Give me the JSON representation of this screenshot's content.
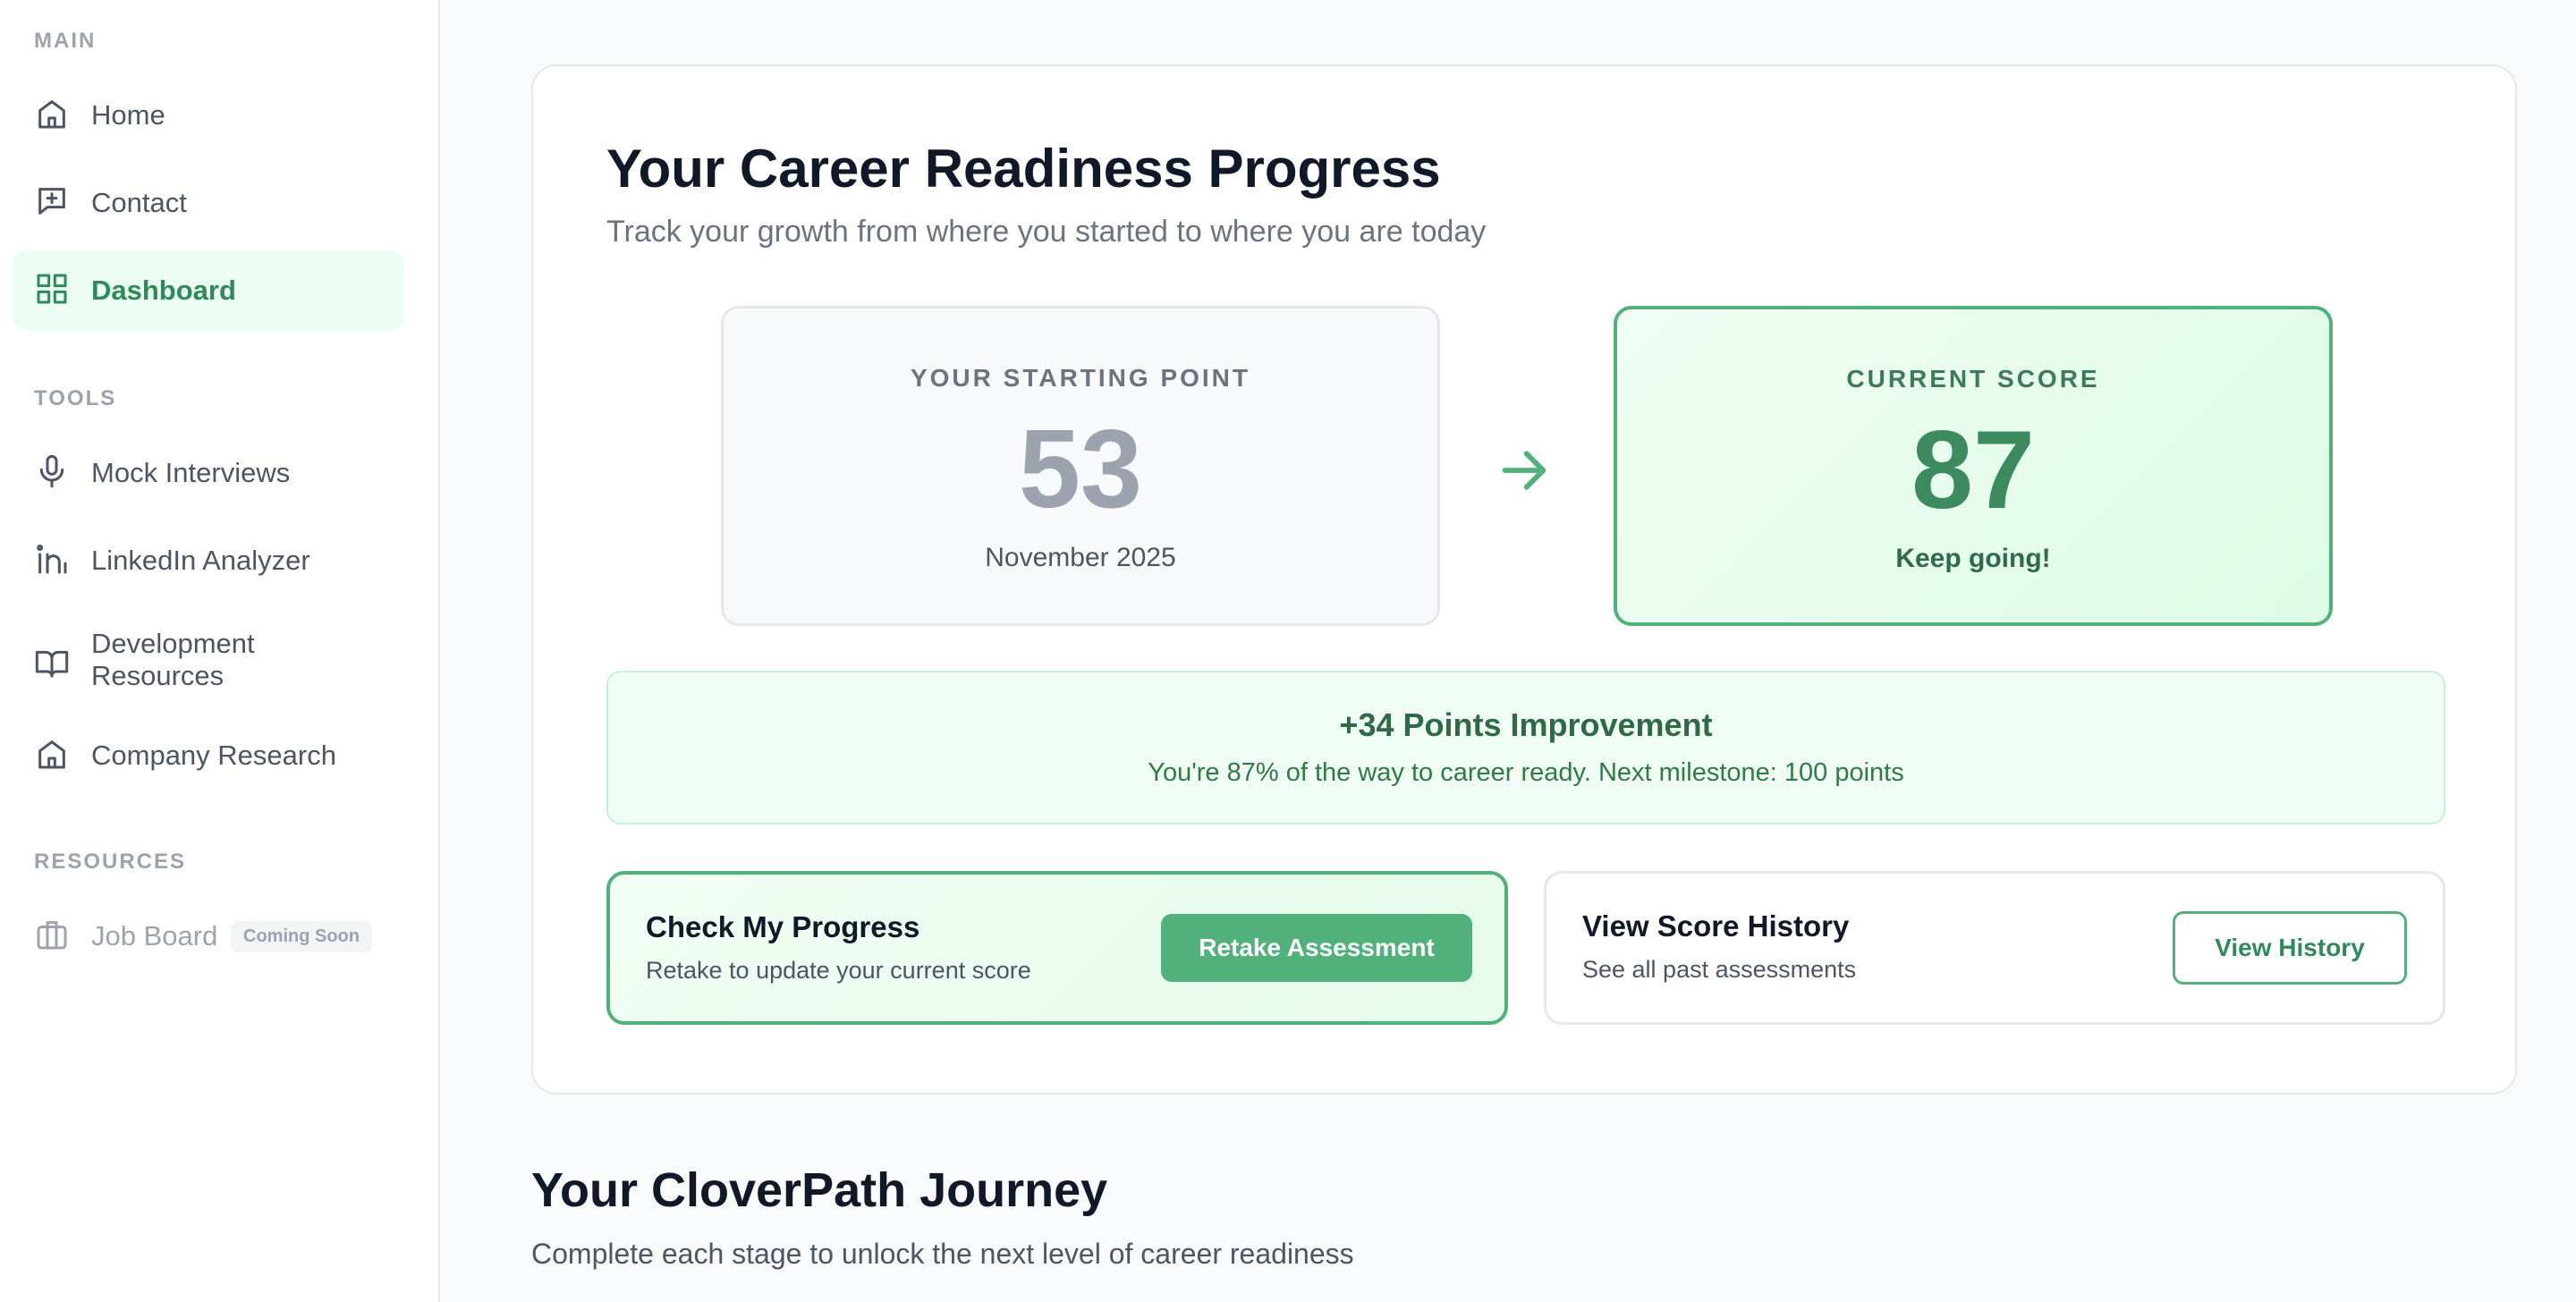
{
  "sidebar": {
    "sections": {
      "main": "MAIN",
      "tools": "TOOLS",
      "resources": "RESOURCES"
    },
    "items": [
      {
        "label": "Home",
        "icon": "home-icon"
      },
      {
        "label": "Contact",
        "icon": "message-plus-icon"
      },
      {
        "label": "Dashboard",
        "icon": "grid-icon",
        "active": true
      },
      {
        "label": "Mock Interviews",
        "icon": "microphone-icon"
      },
      {
        "label": "LinkedIn Analyzer",
        "icon": "linkedin-icon"
      },
      {
        "label_line1": "Development",
        "label_line2": "Resources",
        "icon": "book-open-icon"
      },
      {
        "label": "Company Research",
        "icon": "home-icon"
      },
      {
        "label": "Job Board",
        "icon": "briefcase-icon",
        "badge": "Coming Soon",
        "disabled": true
      }
    ]
  },
  "progress": {
    "title": "Your Career Readiness Progress",
    "subtitle": "Track your growth from where you started to where you are today",
    "start": {
      "label": "YOUR STARTING POINT",
      "score": "53",
      "caption": "November 2025"
    },
    "current": {
      "label": "CURRENT SCORE",
      "score": "87",
      "caption": "Keep going!"
    },
    "improvement": {
      "title": "+34 Points Improvement",
      "text": "You're 87% of the way to career ready. Next milestone: 100 points"
    },
    "check": {
      "title": "Check My Progress",
      "text": "Retake to update your current score",
      "button": "Retake Assessment"
    },
    "history": {
      "title": "View Score History",
      "text": "See all past assessments",
      "button": "View History"
    }
  },
  "journey": {
    "title": "Your CloverPath Journey",
    "subtitle": "Complete each stage to unlock the next level of career readiness"
  },
  "colors": {
    "accent": "#52b07b",
    "accent_dark": "#2f8a59",
    "muted": "#9ca3af"
  }
}
